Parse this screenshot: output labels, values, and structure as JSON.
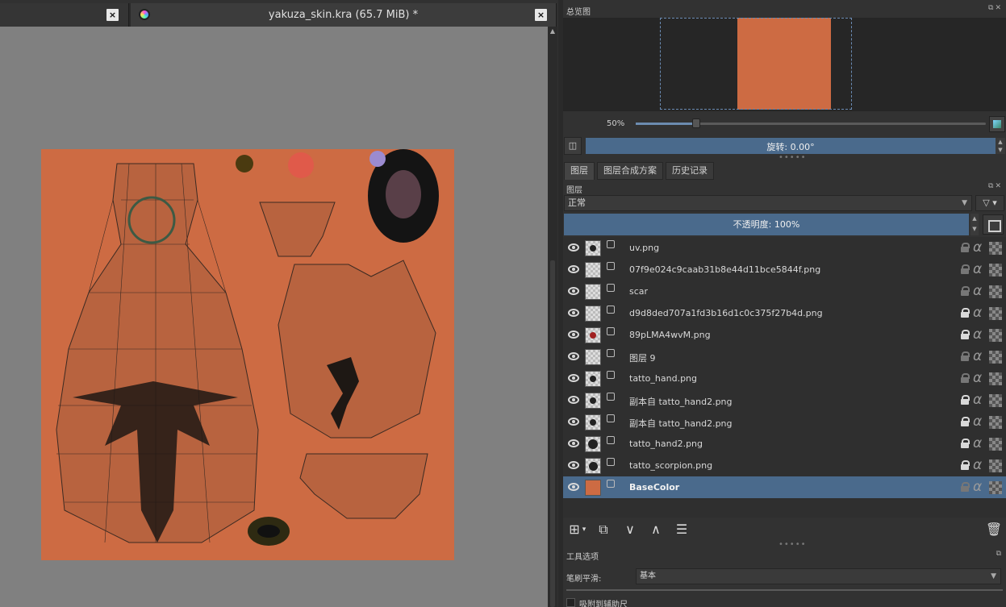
{
  "tabs": [
    {
      "title": "",
      "close": "×"
    },
    {
      "title": "yakuza_skin.kra (65.7 MiB) *",
      "close": "×"
    }
  ],
  "overview": {
    "title": "总览图"
  },
  "zoom": {
    "label": "50%",
    "value_percent": 50
  },
  "rotation": {
    "text": "旋转: 0.00°"
  },
  "docker_tabs": [
    {
      "label": "图层"
    },
    {
      "label": "图层合成方案"
    },
    {
      "label": "历史记录"
    }
  ],
  "layers_panel": {
    "title": "图层",
    "blend_mode": "正常",
    "opacity": "不透明度:  100%"
  },
  "layers": [
    {
      "name": "uv.png",
      "locked": false
    },
    {
      "name": "07f9e024c9caab31b8e44d11bce5844f.png",
      "locked": false
    },
    {
      "name": "scar",
      "locked": false
    },
    {
      "name": "d9d8ded707a1fd3b16d1c0c375f27b4d.png",
      "locked": true
    },
    {
      "name": "89pLMA4wvM.png",
      "locked": true
    },
    {
      "name": "图层 9",
      "locked": false
    },
    {
      "name": "tatto_hand.png",
      "locked": false
    },
    {
      "name": "副本自 tatto_hand2.png",
      "locked": true
    },
    {
      "name": "副本自 tatto_hand2.png",
      "locked": true
    },
    {
      "name": "tatto_hand2.png",
      "locked": true
    },
    {
      "name": "tatto_scorpion.png",
      "locked": true
    },
    {
      "name": "BaseColor",
      "locked": false,
      "selected": true
    }
  ],
  "tool_options": {
    "title": "工具选项",
    "brush_smoothing_label": "笔刷平滑:",
    "brush_smoothing_value": "基本",
    "snap_label": "吸附到辅助尺"
  },
  "colors": {
    "canvas_bg": "#808080",
    "texture_orange": "#cd6b43",
    "selection_blue": "#4a6a8c"
  }
}
